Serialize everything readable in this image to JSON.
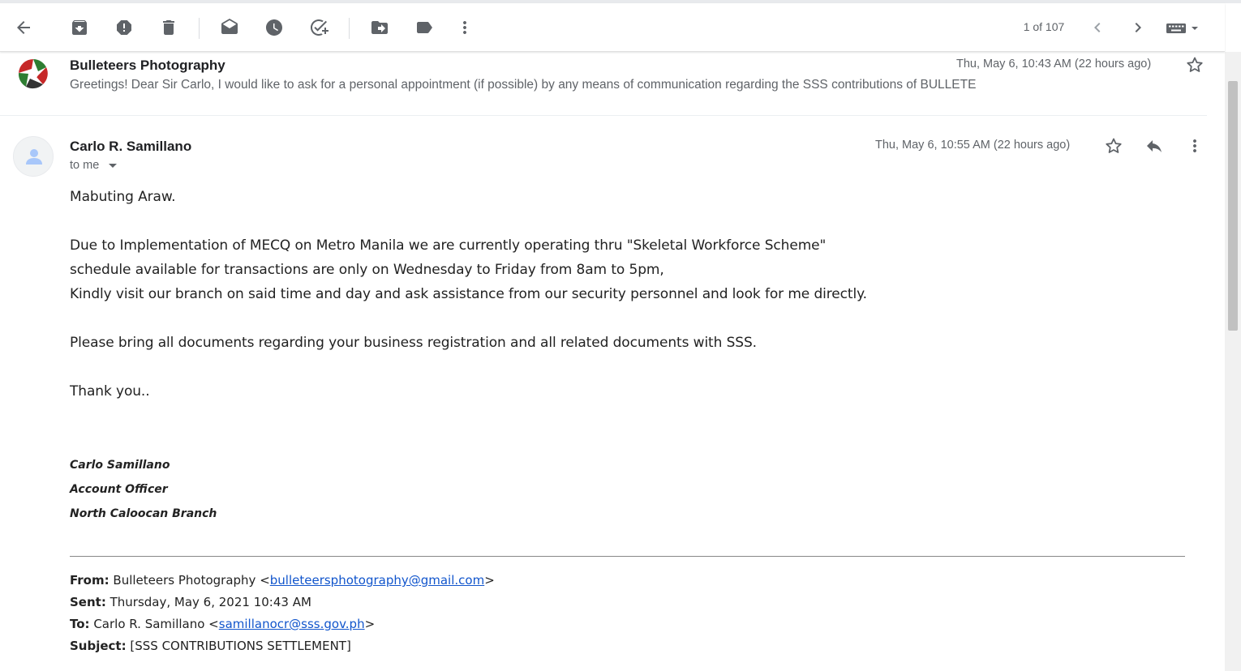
{
  "toolbar": {
    "icons": [
      "back-arrow-icon",
      "archive-icon",
      "report-spam-icon",
      "delete-icon",
      "mark-unread-icon",
      "snooze-icon",
      "add-task-icon",
      "move-to-icon",
      "label-icon",
      "more-vert-icon"
    ],
    "pager": "1 of 107",
    "input_tools": "keyboard-icon"
  },
  "thread": {
    "collapsed_message": {
      "sender": "Bulleteers Photography",
      "date": "Thu, May 6, 10:43 AM (22 hours ago)",
      "snippet": "Greetings! Dear Sir Carlo, I would like to ask for a personal appointment (if possible) by any means of communication regarding the SSS contributions of BULLETE"
    },
    "open_message": {
      "sender": "Carlo R. Samillano",
      "to": "to me",
      "date": "Thu, May 6, 10:55 AM (22 hours ago)",
      "greeting": "Mabuting Araw.",
      "lines": [
        "Due to Implementation of MECQ on Metro Manila we are currently operating thru \"Skeletal Workforce Scheme\"",
        "schedule available for transactions are only on Wednesday to Friday from 8am to 5pm,",
        "Kindly visit our branch on said time and day and ask assistance from our security personnel and look for me directly."
      ],
      "documents_note": "Please bring all documents regarding your business registration and all related documents with SSS.",
      "thanks": "Thank you..",
      "signature": {
        "name": "Carlo Samillano",
        "title": "Account Officer",
        "branch": "North Caloocan Branch"
      },
      "quoted_header": {
        "from_label": "From:",
        "from_name": "Bulleteers Photography <",
        "from_email": "bulleteersphotography@gmail.com",
        "from_close": ">",
        "sent_label": "Sent:",
        "sent_value": "Thursday, May 6, 2021 10:43 AM",
        "to_label": "To:",
        "to_name": "Carlo R. Samillano <",
        "to_email": "samillanocr@sss.gov.ph",
        "to_close": ">",
        "subject_label": "Subject:",
        "subject_value": "[SSS CONTRIBUTIONS SETTLEMENT]"
      }
    }
  },
  "colors": {
    "icon": "#5f6368",
    "text": "#202124",
    "muted": "#5f6368",
    "link": "#1155cc"
  }
}
